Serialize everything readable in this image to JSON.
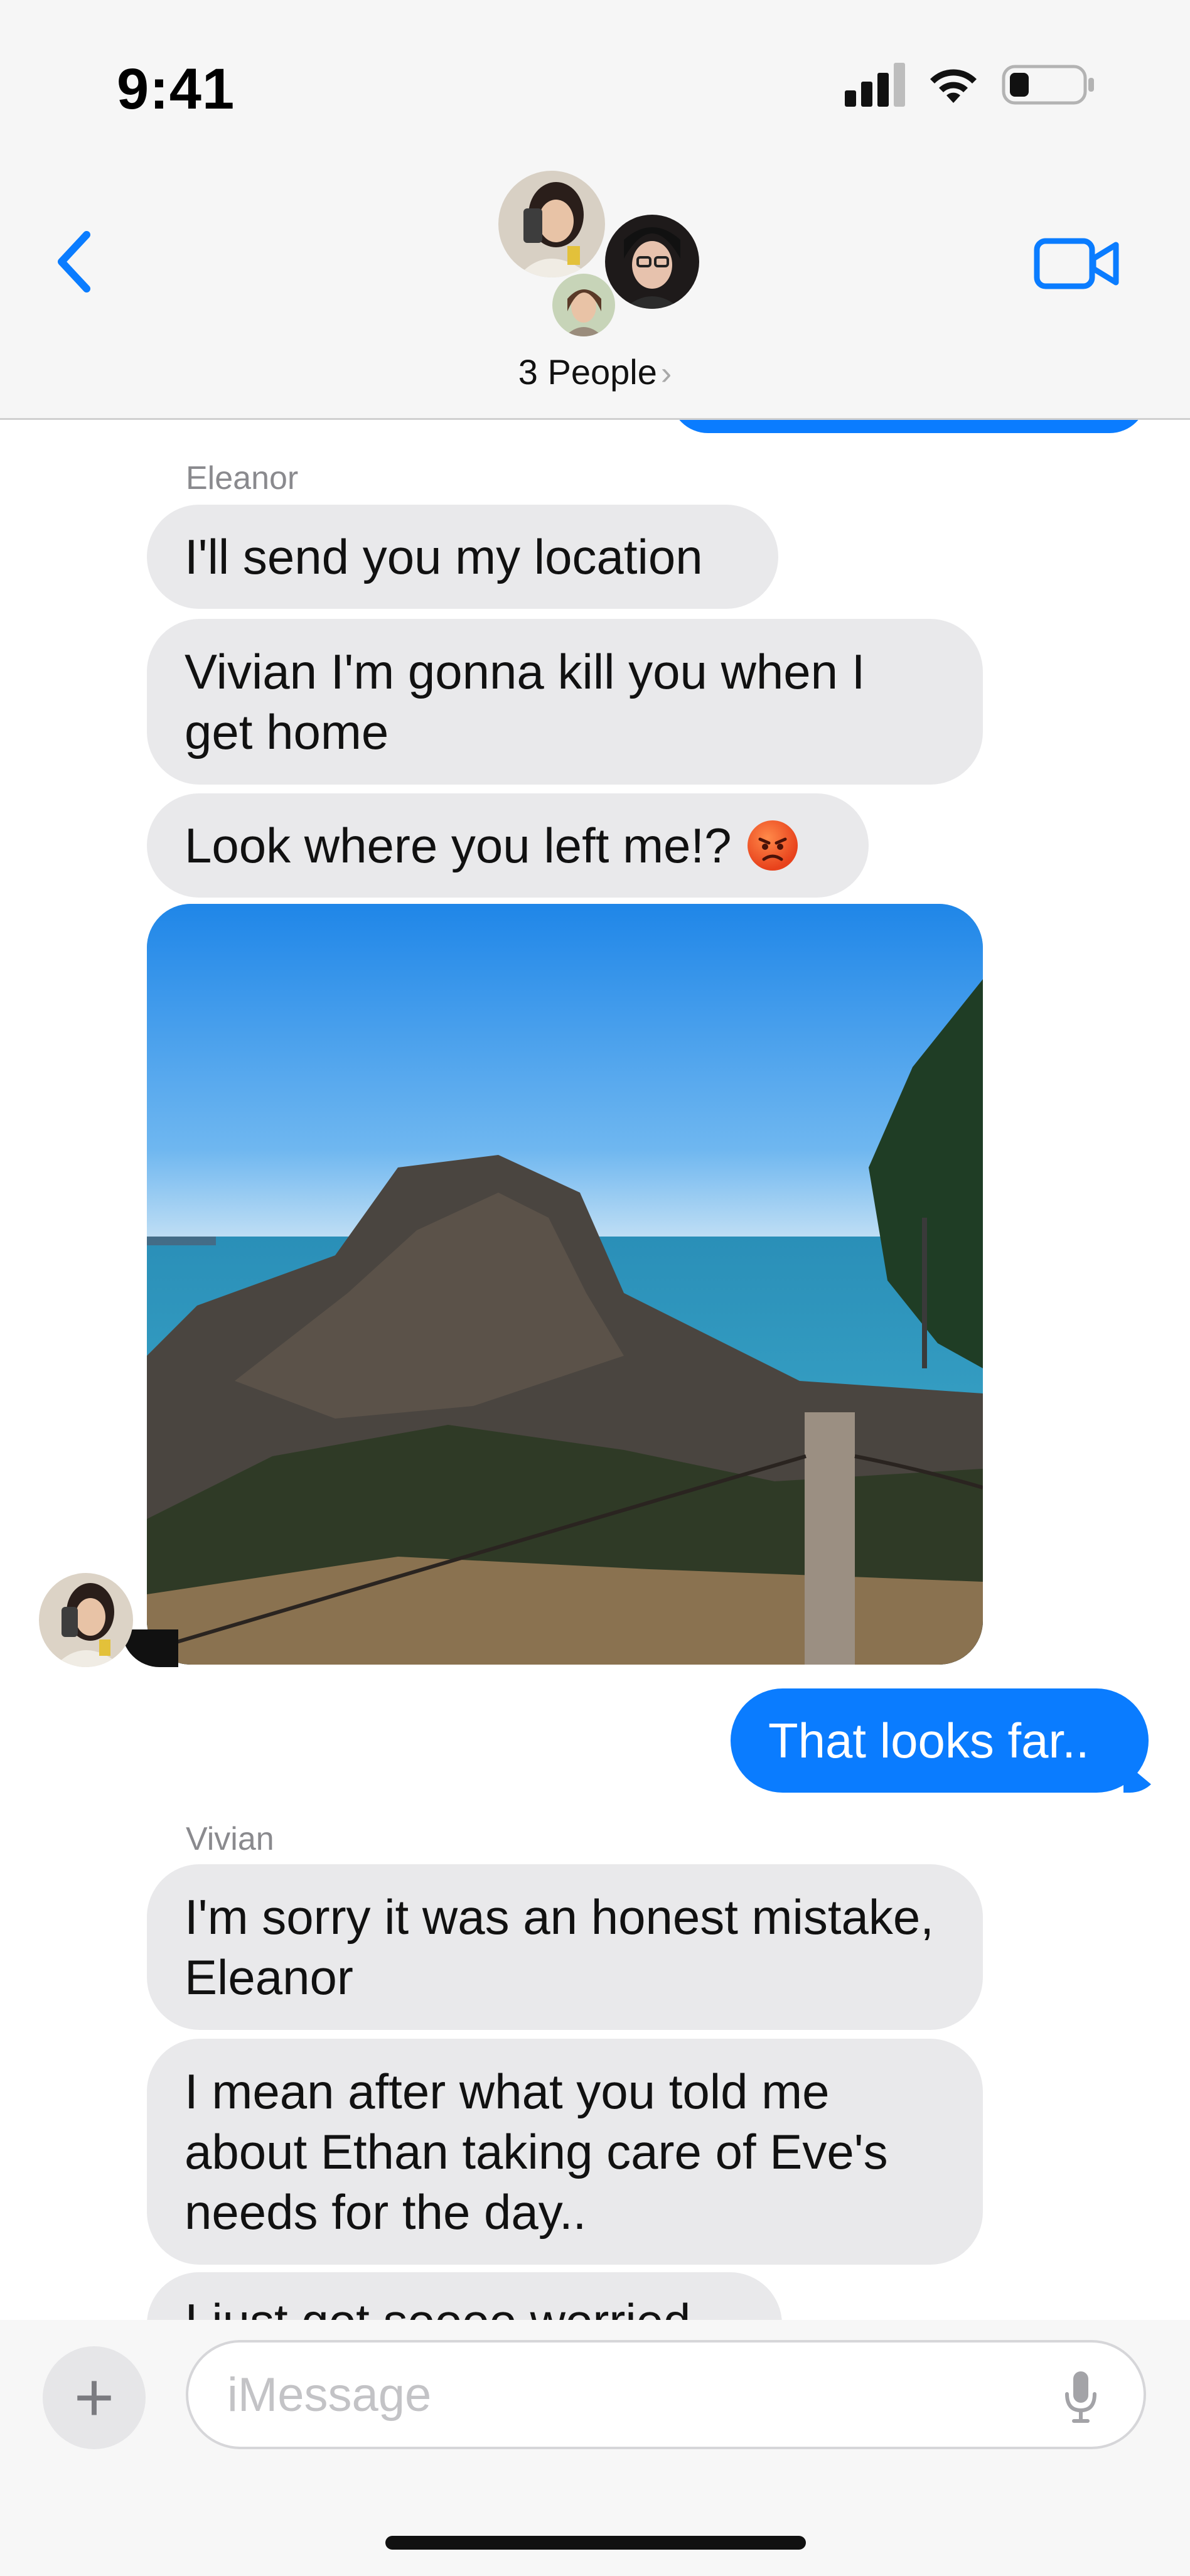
{
  "status_bar": {
    "time": "9:41"
  },
  "header": {
    "group_label": "3 People",
    "chevron": "›"
  },
  "messages": [
    {
      "sender": "Eleanor",
      "text": "I'll send you my location"
    },
    {
      "text": "Vivian I'm gonna kill you when I get home"
    },
    {
      "text": "Look where you left me!?",
      "emoji": "angry-face"
    },
    {
      "outgoing": "That looks far.."
    },
    {
      "sender": "Vivian",
      "text": "I'm sorry it was an honest mistake, Eleanor"
    },
    {
      "text": "I mean after what you told me about Ethan taking care of Eve's needs for the day.."
    },
    {
      "text": "I just got soooo worried"
    }
  ],
  "composer": {
    "placeholder": "iMessage",
    "plus": "+"
  },
  "colors": {
    "accent": "#0A7CFF",
    "incoming_bubble": "#E9E9EB",
    "header_bg": "#F6F6F6"
  },
  "icons": {
    "back": "chevron-left-icon",
    "video": "video-camera-icon",
    "signal": "cellular-signal-icon",
    "wifi": "wifi-icon",
    "battery": "battery-icon",
    "mic": "microphone-icon"
  }
}
